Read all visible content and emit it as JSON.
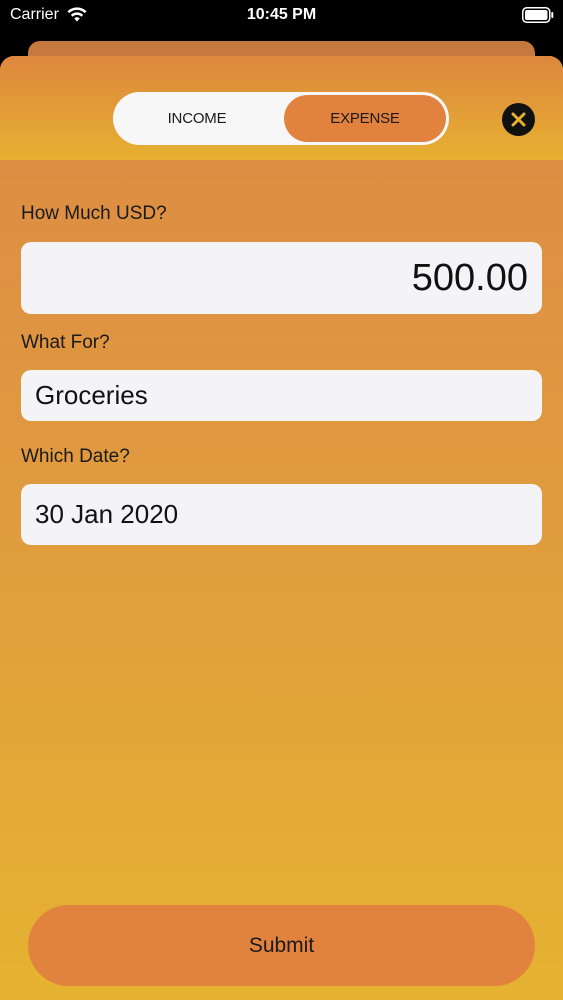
{
  "status_bar": {
    "carrier": "Carrier",
    "time": "10:45 PM",
    "icons": [
      "wifi-icon",
      "battery-icon"
    ]
  },
  "toggle": {
    "income_label": "INCOME",
    "expense_label": "EXPENSE",
    "selected": "EXPENSE"
  },
  "close_icon": "close-icon",
  "form": {
    "amount_label": "How Much USD?",
    "amount_value": "500.00",
    "what_label": "What For?",
    "what_value": "Groceries",
    "date_label": "Which Date?",
    "date_value": "30 Jan 2020"
  },
  "submit_label": "Submit",
  "colors": {
    "accent": "#e1833f",
    "gradient_top": "#dc8a44",
    "gradient_bottom": "#e5b331",
    "field_bg": "#f4f4f6"
  }
}
